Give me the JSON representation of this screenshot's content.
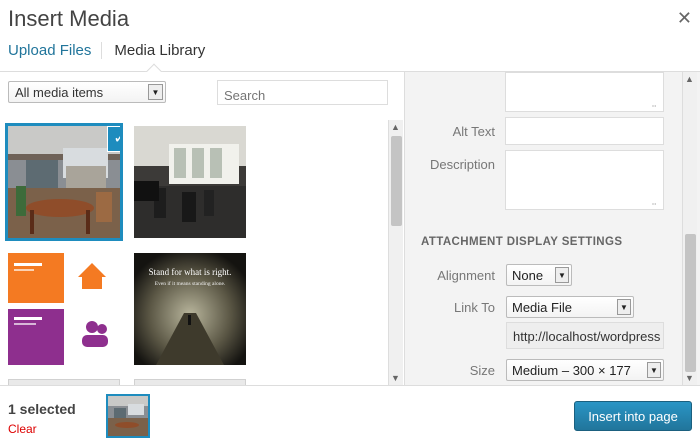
{
  "header": {
    "title": "Insert Media",
    "close_icon": "close-icon",
    "tabs": [
      {
        "label": "Upload Files"
      },
      {
        "label": "Media Library"
      }
    ]
  },
  "filters": {
    "media_type": "All media items",
    "search_placeholder": "Search"
  },
  "details": {
    "alt_text_label": "Alt Text",
    "description_label": "Description",
    "display_settings_title": "ATTACHMENT DISPLAY SETTINGS",
    "alignment_label": "Alignment",
    "alignment_value": "None",
    "link_to_label": "Link To",
    "link_to_value": "Media File",
    "url_value": "http://localhost/wordpress",
    "size_label": "Size",
    "size_value": "Medium – 300 × 177"
  },
  "thumb4": {
    "line1": "Stand for what is right.",
    "line2": "Even if it means standing alone."
  },
  "toolbar": {
    "selected_count": "1 selected",
    "clear_label": "Clear",
    "insert_label": "Insert into page"
  },
  "colors": {
    "accent": "#1e8cbe",
    "clear": "#dd0000"
  }
}
